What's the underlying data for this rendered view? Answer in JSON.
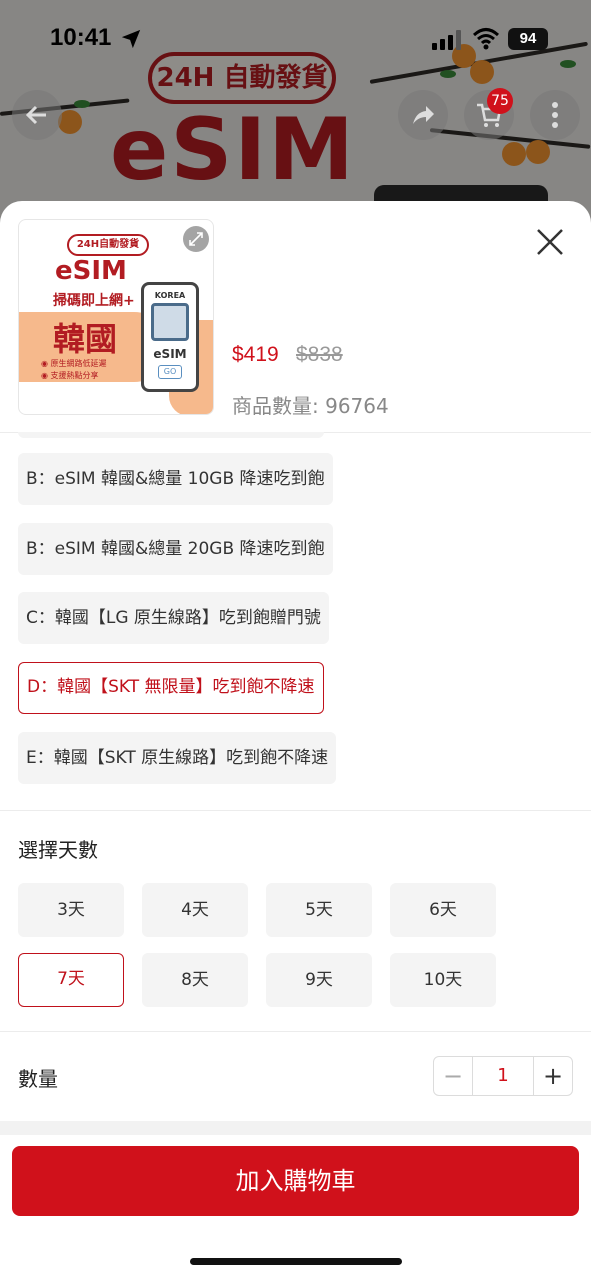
{
  "status_bar": {
    "time": "10:41",
    "battery": "94"
  },
  "banner": {
    "pill_text": "24H 自動發貨",
    "headline": "eSIM"
  },
  "cart_badge": "75",
  "product": {
    "thumb_pill": "24H自動發貨",
    "thumb_esim": "eSIM",
    "thumb_sub": "掃碼即上網+",
    "thumb_country": "韓國",
    "thumb_bullet1": "◉ 原生網路低延遲",
    "thumb_bullet2": "◉ 支援熱點分享",
    "thumb_phone_top": "KOREA",
    "thumb_phone_esim": "eSIM",
    "thumb_phone_go": "GO",
    "price": "$419",
    "original_price": "$838",
    "stock_label": "商品數量: 96764"
  },
  "options": [
    {
      "label": "B：eSIM 韓國&總量 10GB 降速吃到飽",
      "selected": false
    },
    {
      "label": "B：eSIM 韓國&總量 20GB 降速吃到飽",
      "selected": false
    },
    {
      "label": "C：韓國【LG 原生線路】吃到飽贈門號",
      "selected": false
    },
    {
      "label": "D：韓國【SKT 無限量】吃到飽不降速",
      "selected": true
    },
    {
      "label": "E：韓國【SKT 原生線路】吃到飽不降速",
      "selected": false
    }
  ],
  "days_section": {
    "title": "選擇天數",
    "days": [
      {
        "label": "3天",
        "selected": false
      },
      {
        "label": "4天",
        "selected": false
      },
      {
        "label": "5天",
        "selected": false
      },
      {
        "label": "6天",
        "selected": false
      },
      {
        "label": "7天",
        "selected": true
      },
      {
        "label": "8天",
        "selected": false
      },
      {
        "label": "9天",
        "selected": false
      },
      {
        "label": "10天",
        "selected": false
      }
    ]
  },
  "quantity": {
    "label": "數量",
    "value": "1",
    "minus": "−",
    "plus": "+"
  },
  "add_to_cart": "加入購物車",
  "colors": {
    "accent": "#d0111b"
  }
}
